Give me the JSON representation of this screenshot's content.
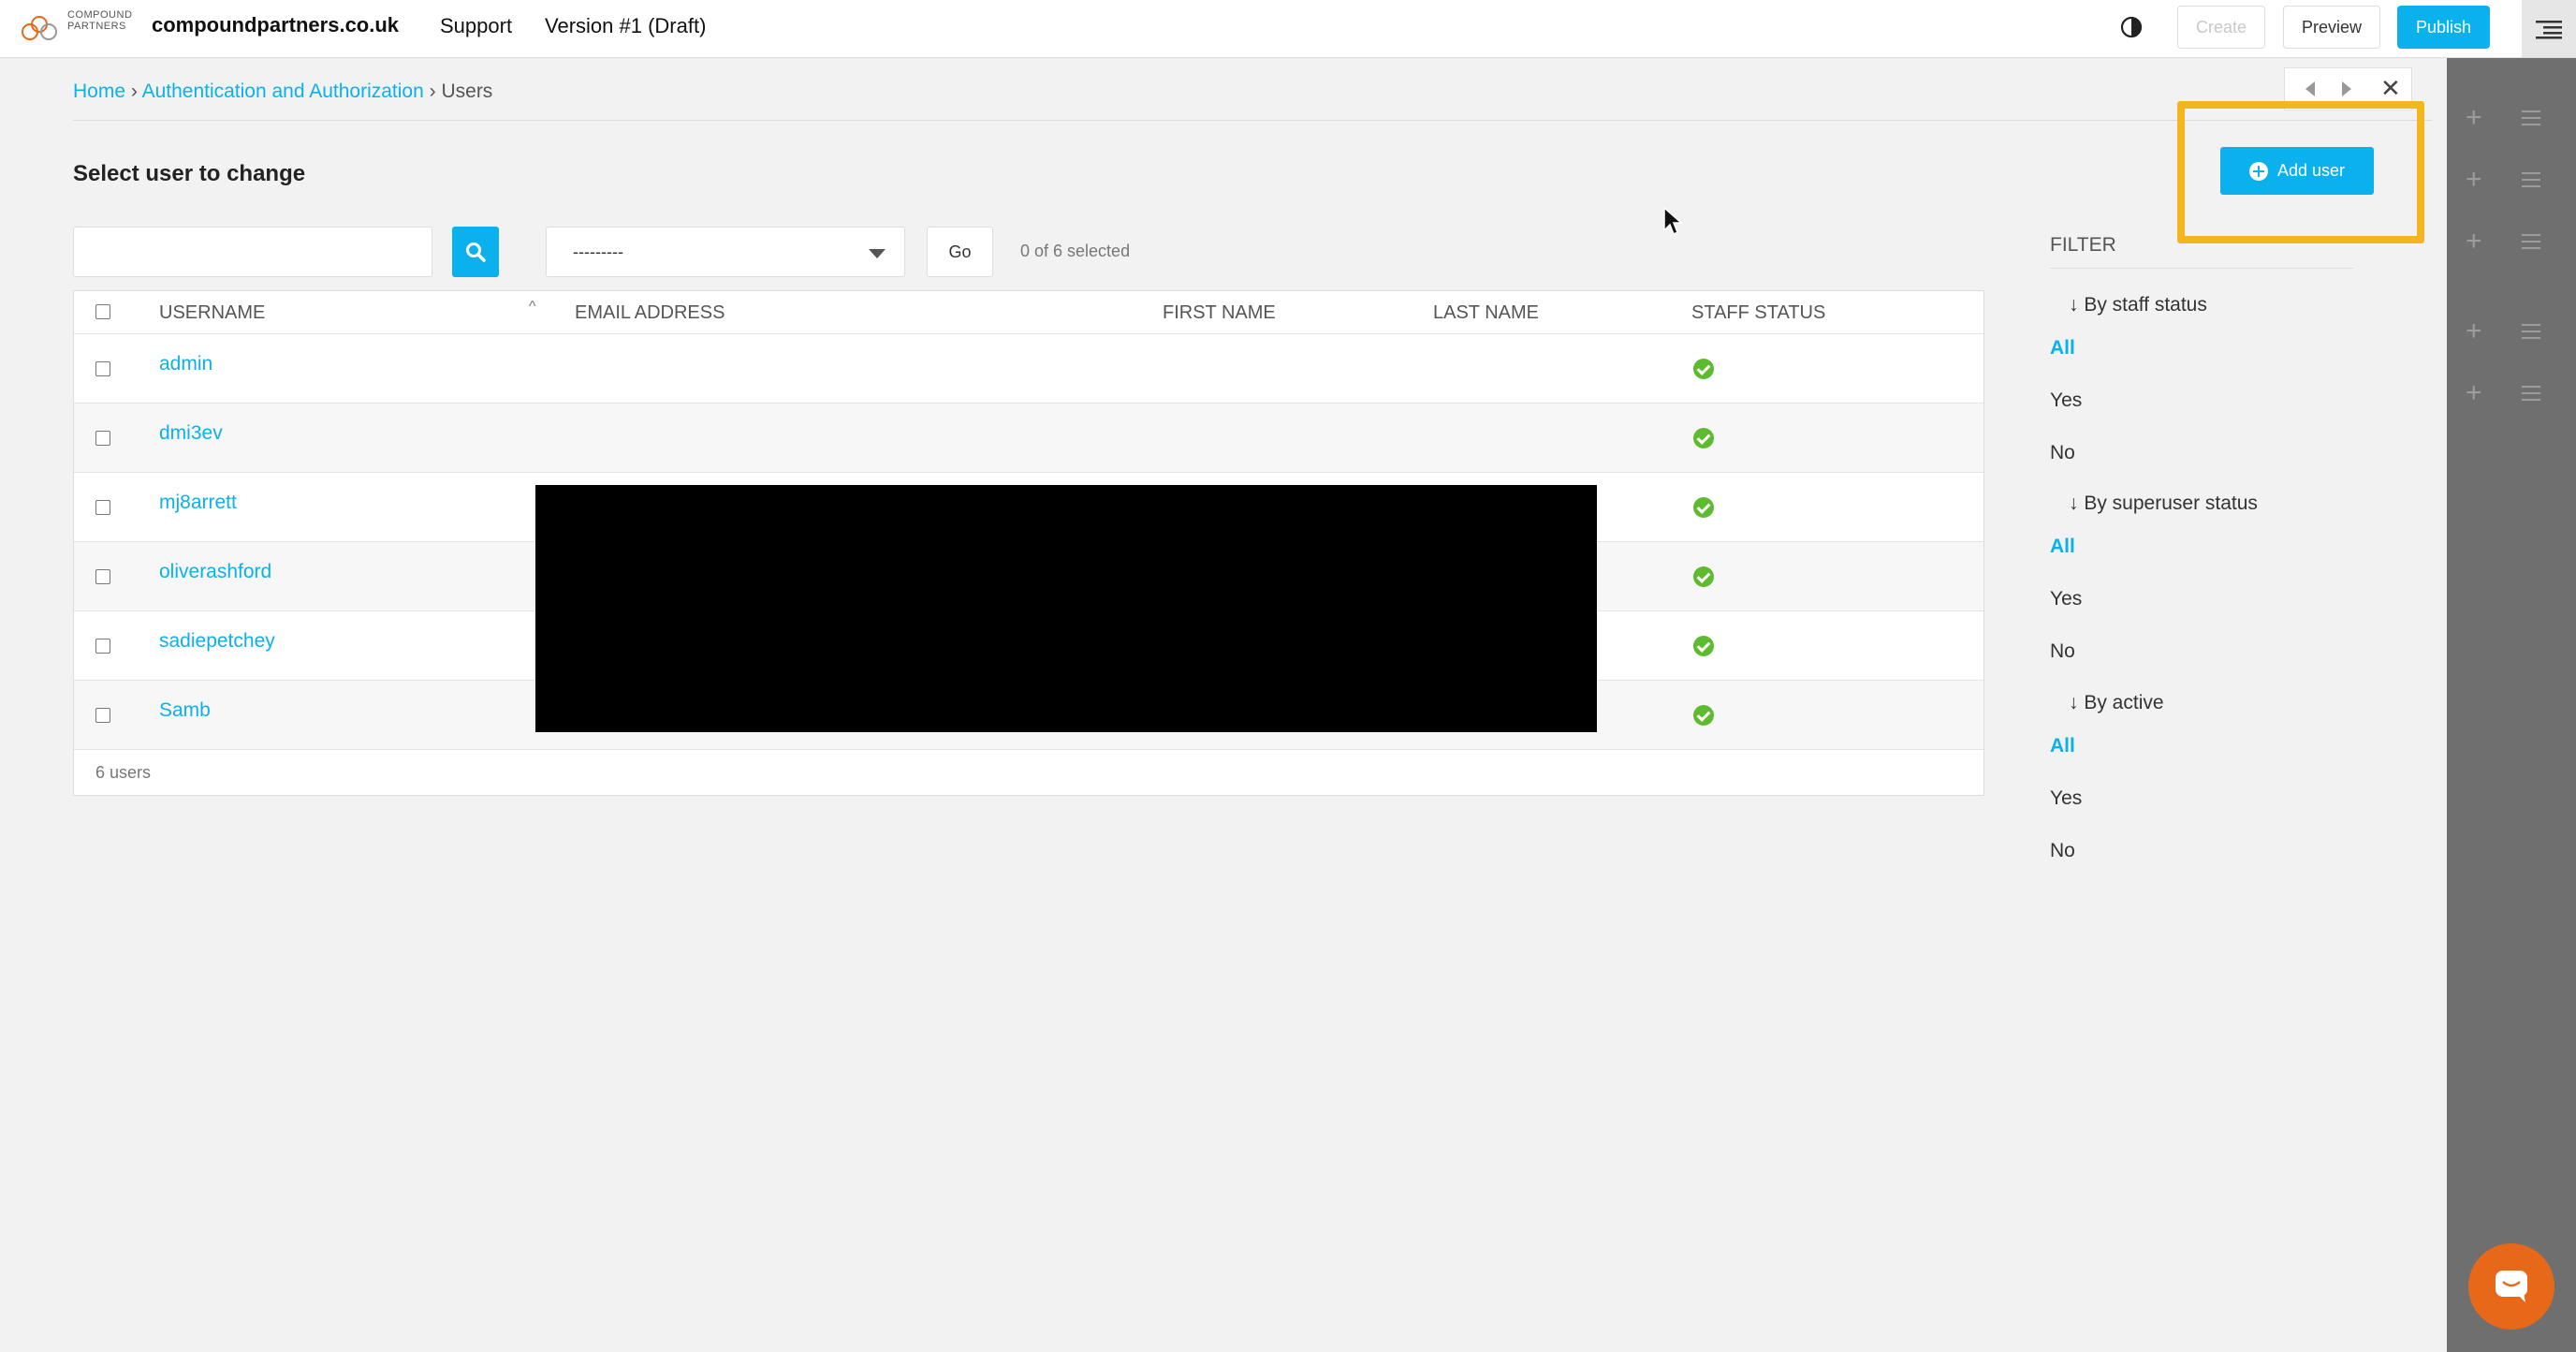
{
  "toolbar": {
    "logo_text_line1": "COMPOUND",
    "logo_text_line2": "PARTNERS",
    "site": "compoundpartners.co.uk",
    "support": "Support",
    "version": "Version #1 (Draft)",
    "create": "Create",
    "preview": "Preview",
    "publish": "Publish"
  },
  "breadcrumb": {
    "home": "Home",
    "section": "Authentication and Authorization",
    "current": "Users",
    "sep": "›"
  },
  "page": {
    "title": "Select user to change",
    "add_user": "Add user"
  },
  "actions": {
    "select_value": "---------",
    "go": "Go",
    "selected": "0 of 6 selected"
  },
  "table": {
    "headers": [
      "Username",
      "Email address",
      "First name",
      "Last name",
      "Staff status"
    ],
    "rows": [
      {
        "username": "admin",
        "staff": true
      },
      {
        "username": "dmi3ev",
        "staff": true
      },
      {
        "username": "mj8arrett",
        "staff": true
      },
      {
        "username": "oliverashford",
        "staff": true
      },
      {
        "username": "sadiepetchey",
        "staff": true
      },
      {
        "username": "Samb",
        "staff": true
      }
    ],
    "footer": "6 users"
  },
  "filter": {
    "title": "FILTER",
    "groups": [
      {
        "heading": "↓ By staff status",
        "options": [
          "All",
          "Yes",
          "No"
        ],
        "selected": "All"
      },
      {
        "heading": "↓ By superuser status",
        "options": [
          "All",
          "Yes",
          "No"
        ],
        "selected": "All"
      },
      {
        "heading": "↓ By active",
        "options": [
          "All",
          "Yes",
          "No"
        ],
        "selected": "All"
      }
    ]
  },
  "colors": {
    "accent": "#0bb1ec",
    "highlight": "#f4b61f",
    "success": "#5dbb2f",
    "chat": "#e8681a"
  }
}
